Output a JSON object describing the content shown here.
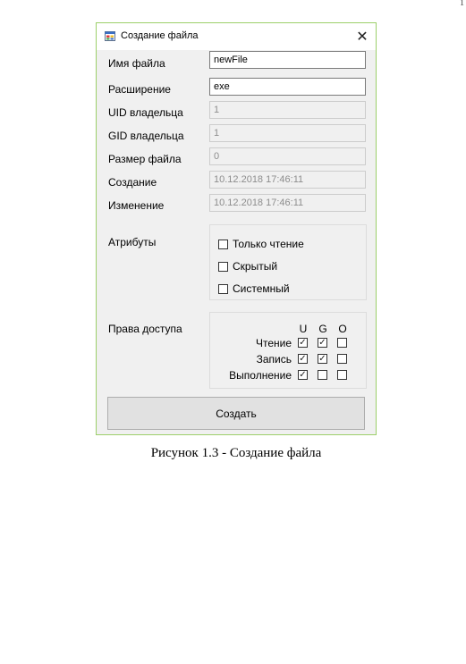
{
  "page": {
    "corner_mark": "1"
  },
  "window": {
    "title": "Создание файла",
    "icon": "application-icon",
    "close_glyph": "✕"
  },
  "form": {
    "fields": [
      {
        "label": "Имя файла",
        "value": "newFile",
        "enabled": true
      },
      {
        "label": "Расширение",
        "value": "exe",
        "enabled": true
      },
      {
        "label": "UID владельца",
        "value": "1",
        "enabled": false
      },
      {
        "label": "GID владельца",
        "value": "1",
        "enabled": false
      },
      {
        "label": "Размер файла",
        "value": "0",
        "enabled": false
      },
      {
        "label": "Создание",
        "value": "10.12.2018 17:46:11",
        "enabled": false
      },
      {
        "label": "Изменение",
        "value": "10.12.2018 17:46:11",
        "enabled": false
      }
    ],
    "attributes": {
      "label": "Атрибуты",
      "items": [
        {
          "label": "Только чтение",
          "checked": false
        },
        {
          "label": "Скрытый",
          "checked": false
        },
        {
          "label": "Системный",
          "checked": false
        }
      ]
    },
    "permissions": {
      "label": "Права доступа",
      "columns": [
        "U",
        "G",
        "O"
      ],
      "rows": [
        {
          "label": "Чтение",
          "values": [
            true,
            true,
            false
          ]
        },
        {
          "label": "Запись",
          "values": [
            true,
            true,
            false
          ]
        },
        {
          "label": "Выполнение",
          "values": [
            true,
            false,
            false
          ]
        }
      ]
    },
    "create_button": "Создать"
  },
  "caption": "Рисунок 1.3 - Создание файла",
  "colors": {
    "window_border": "#9ccf6a",
    "dialog_bg": "#f0f0f0",
    "button_bg": "#e1e1e1"
  }
}
